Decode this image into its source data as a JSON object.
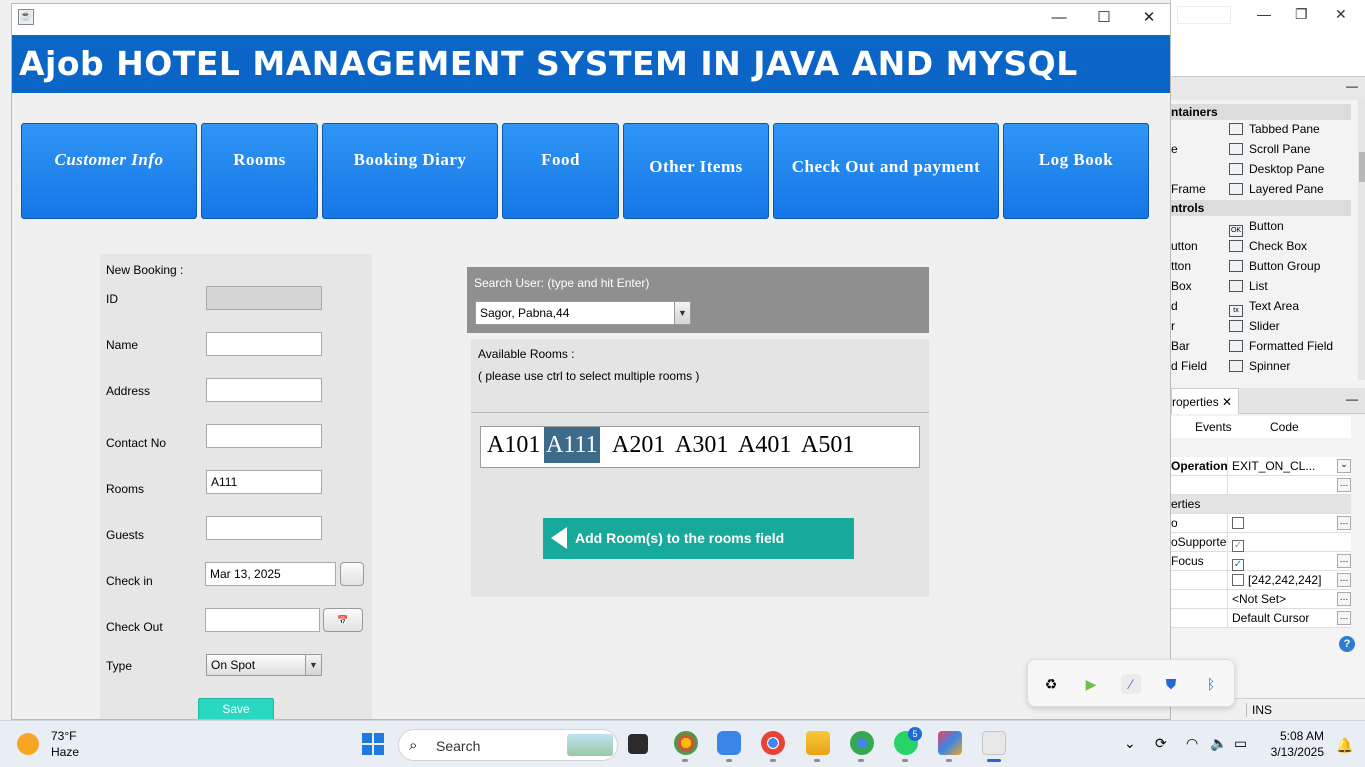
{
  "window": {
    "title_controls": {
      "minimize": "—",
      "maximize": "☐",
      "close": "✕"
    },
    "banner_title": "Ajob HOTEL MANAGEMENT SYSTEM IN JAVA AND MYSQL",
    "accent_color": "#0a65c7"
  },
  "nav": [
    {
      "label": "Customer Info"
    },
    {
      "label": "Rooms"
    },
    {
      "label": "Booking Diary"
    },
    {
      "label": "Food"
    },
    {
      "label": "Other Items"
    },
    {
      "label": "Check Out and payment"
    },
    {
      "label": "Log Book"
    }
  ],
  "booking": {
    "heading": "New Booking :",
    "id_label": "ID",
    "id_value": "",
    "name_label": "Name",
    "name_value": "",
    "address_label": "Address",
    "address_value": "",
    "contact_label": "Contact No",
    "contact_value": "",
    "rooms_label": "Rooms",
    "rooms_value": "A111",
    "guests_label": "Guests",
    "guests_value": "",
    "checkin_label": "Check in",
    "checkin_value": "Mar 13, 2025",
    "checkout_label": "Check Out",
    "checkout_value": "",
    "type_label": "Type",
    "type_value": "On Spot",
    "save_label": "Save"
  },
  "search": {
    "label": "Search User: (type and hit Enter)",
    "selected_user": "Sagor, Pabna,44"
  },
  "rooms": {
    "heading": "Available Rooms :",
    "hint": "( please use ctrl to select multiple rooms )",
    "list": [
      "A101",
      "A111",
      "A201",
      "A301",
      "A401",
      "A501"
    ],
    "selected": "A111",
    "add_button": "Add Room(s) to the rooms field"
  },
  "ide": {
    "palette_sections": [
      "ntainers",
      "ntrols"
    ],
    "palette_items": [
      "Tabbed Pane",
      "Scroll Pane",
      "Desktop Pane",
      "Layered Pane",
      "Button",
      "Check Box",
      "Button Group",
      "List",
      "Text Area",
      "Slider",
      "Formatted Field",
      "Spinner"
    ],
    "palette_left": [
      "e",
      "Frame",
      "utton",
      "tton",
      "Box",
      "d",
      "r",
      "Bar",
      "d Field"
    ],
    "props_tab": "roperties",
    "tabs": [
      "Events",
      "Code"
    ],
    "prop_rows": [
      {
        "k": "Operation",
        "v": "EXIT_ON_CL..."
      },
      {
        "k": "",
        "v": ""
      },
      {
        "k": "erties",
        "v": ""
      },
      {
        "k": "o",
        "v": ""
      },
      {
        "k": "oSupportec",
        "v": ""
      },
      {
        "k": "Focus",
        "v": ""
      },
      {
        "k": "",
        "v": "[242,242,242]"
      },
      {
        "k": "",
        "v": "<Not Set>"
      },
      {
        "k": "",
        "v": "Default Cursor"
      }
    ],
    "status_mode": "INS"
  },
  "taskbar": {
    "temperature": "73°F",
    "condition": "Haze",
    "search_placeholder": "Search",
    "whatsapp_badge": "5",
    "time": "5:08 AM",
    "date": "3/13/2025"
  }
}
